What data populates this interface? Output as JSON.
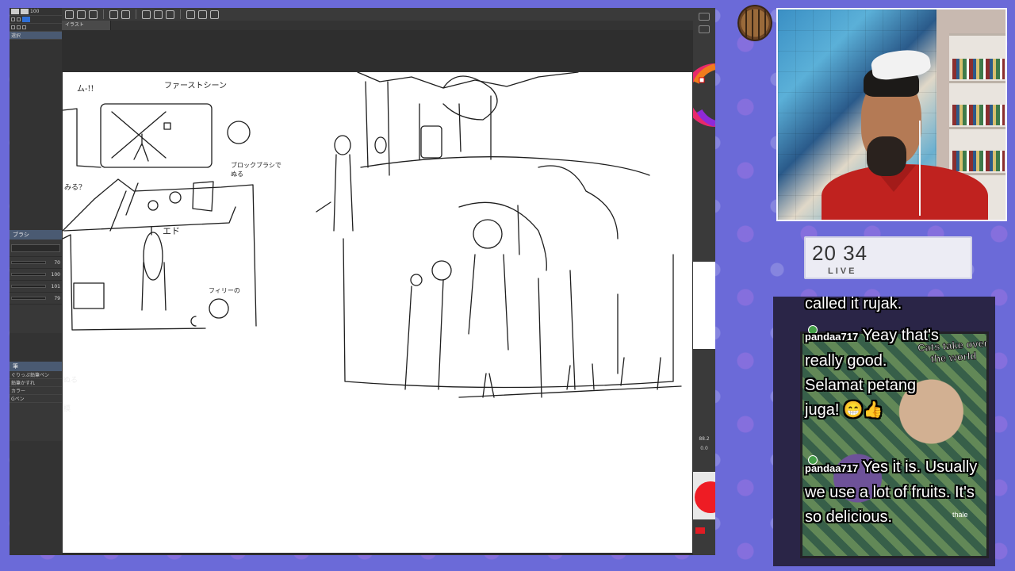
{
  "app": {
    "doc_tab": "イラスト",
    "left_panel": {
      "header_sub": "選択",
      "brush_panel_title": "筆",
      "brush_names": [
        "ぐりっぷ鉛筆ペン",
        "鉛筆かすれ",
        "カラー",
        "Gペン"
      ],
      "brush_panel_label": "ブラシ",
      "slider_values": [
        "70",
        "100",
        "101",
        "79"
      ],
      "size_value": "100"
    },
    "sketch_notes": {
      "exclaim": "ム-!!",
      "first_scene": "ファーストシーン",
      "block_note": "ブロックブラシで\nぬる",
      "left_note": "みる?",
      "fairy_note": "フィリーの",
      "mid_note": "エド",
      "left_edge_1": "ぬる",
      "left_edge_2": "模"
    },
    "nav_labels": [
      "88.2",
      "0.0"
    ]
  },
  "overlay": {
    "clock_time": "20 34",
    "clock_status": "LIVE",
    "chat_art_title": "Cats take over the world",
    "chat_art_sub": "thale",
    "chat": [
      {
        "user": "",
        "text": "called it rujak."
      },
      {
        "user": "pandaa717",
        "text": "Yeay that's really good. Selamat petang juga! 😁👍"
      },
      {
        "user": "pandaa717",
        "text": "Yes it is. Usually we use a lot of fruits. It's so delicious."
      }
    ]
  },
  "colors": {
    "background": "#6b6ad8",
    "app_dark": "#2b2b2b",
    "shirt_red": "#c0221f",
    "chat_bg": "#2a2547",
    "badge_green": "#46a049"
  }
}
